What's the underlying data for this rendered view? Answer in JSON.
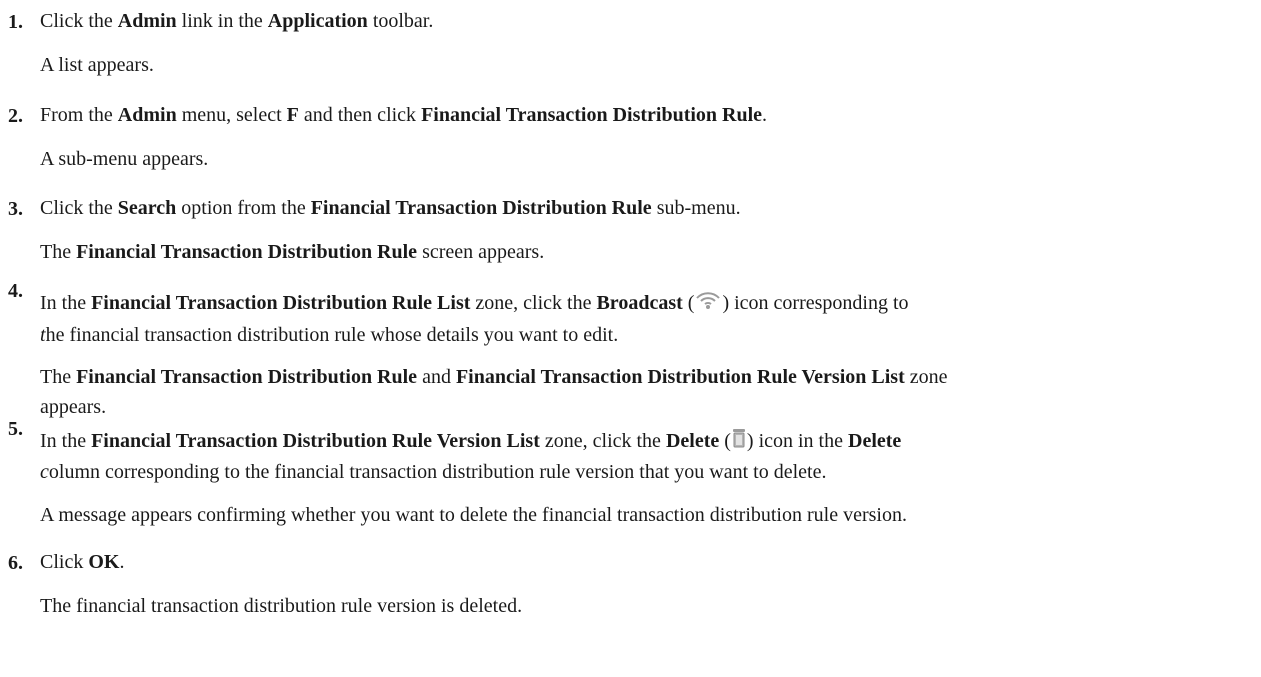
{
  "steps": [
    {
      "num": "1.",
      "parts": [
        "Click the ",
        "Admin",
        " link in the ",
        "Application",
        " toolbar."
      ],
      "result": "A list appears."
    },
    {
      "num": "2.",
      "parts": [
        "From the ",
        "Admin",
        " menu, select ",
        "F",
        " and then click ",
        "Financial Transaction Distribution Rule",
        "."
      ],
      "result": "A sub-menu appears."
    },
    {
      "num": "3.",
      "parts": [
        "Click the ",
        "Search",
        " option from the ",
        "Financial Transaction Distribution Rule",
        " sub-menu."
      ],
      "result_parts": [
        "The ",
        "Financial Transaction Distribution Rule",
        " screen appears."
      ]
    },
    {
      "num": "4.",
      "parts": [
        "In the ",
        "Financial Transaction Distribution Rule List",
        " zone, click the ",
        "Broadcast",
        " (",
        ") icon corresponding to"
      ],
      "line2": [
        "t",
        "he financial transaction distribution rule whose details you want to edit."
      ],
      "result_parts": [
        "The ",
        "Financial Transaction Distribution Rule",
        " and ",
        "Financial Transaction Distribution Rule Version List",
        " zone"
      ],
      "result_line2": "appears.",
      "icon": "broadcast-icon"
    },
    {
      "num": "5.",
      "parts": [
        "In the ",
        "Financial Transaction Distribution Rule Version List",
        " zone, click the ",
        "Delete",
        " (",
        ") icon in the ",
        "Delete"
      ],
      "line2": [
        "c",
        "olumn corresponding to the financial transaction distribution rule version that you want to delete."
      ],
      "result": "A message appears confirming whether you want to delete the financial transaction distribution rule version.",
      "icon": "delete-icon"
    },
    {
      "num": "6.",
      "parts": [
        "Click ",
        "OK",
        "."
      ],
      "result": "The financial transaction distribution rule version is deleted."
    }
  ]
}
